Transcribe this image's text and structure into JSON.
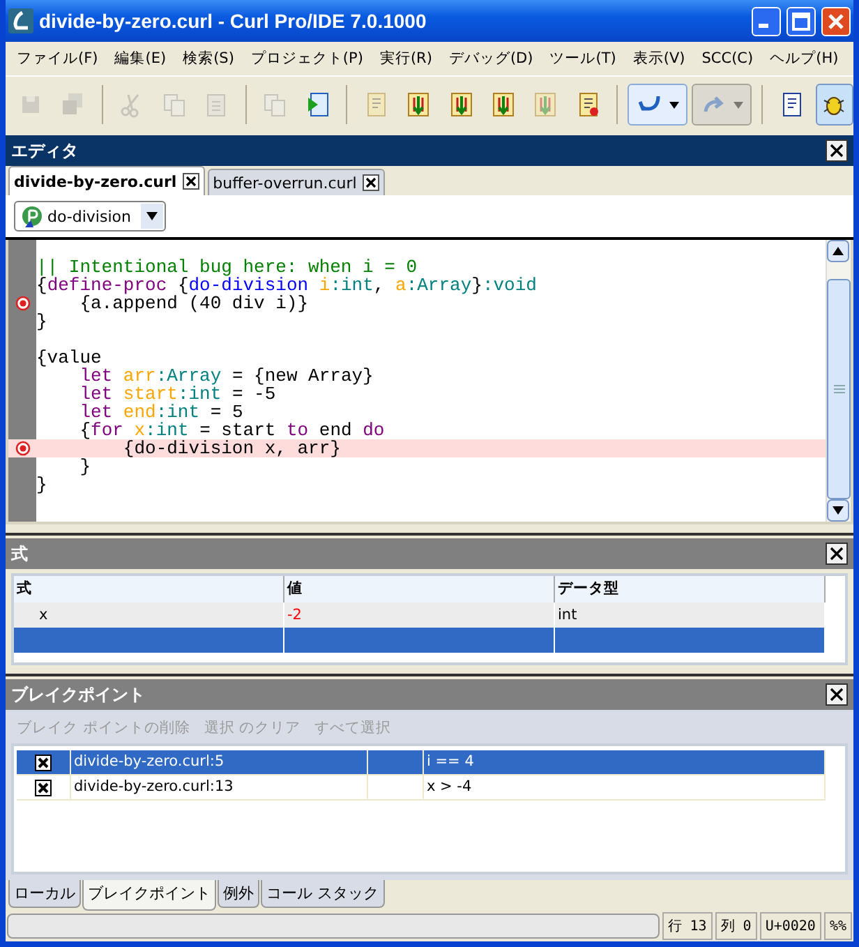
{
  "window": {
    "title": "divide-by-zero.curl - Curl Pro/IDE 7.0.1000"
  },
  "menu": [
    "ファイル(F)",
    "編集(E)",
    "検索(S)",
    "プロジェクト(P)",
    "実行(R)",
    "デバッグ(D)",
    "ツール(T)",
    "表示(V)",
    "SCC(C)",
    "ヘルプ(H)"
  ],
  "toolbar": [
    [
      {
        "kind": "save",
        "disabled": true,
        "pressed": false
      },
      {
        "kind": "save-all",
        "disabled": true,
        "pressed": false
      }
    ],
    [
      {
        "kind": "cut",
        "disabled": true,
        "pressed": false
      },
      {
        "kind": "copy",
        "disabled": true,
        "pressed": false
      },
      {
        "kind": "paste",
        "disabled": true,
        "pressed": false
      }
    ],
    [
      {
        "kind": "documents",
        "disabled": true,
        "pressed": false
      },
      {
        "kind": "run",
        "disabled": false,
        "pressed": false
      }
    ],
    [
      {
        "kind": "document",
        "disabled": true,
        "pressed": false
      },
      {
        "kind": "step-into",
        "disabled": false,
        "pressed": false
      },
      {
        "kind": "step-over",
        "disabled": false,
        "pressed": false
      },
      {
        "kind": "step-out",
        "disabled": false,
        "pressed": false
      },
      {
        "kind": "step-over",
        "disabled": true,
        "pressed": false
      },
      {
        "kind": "stop",
        "disabled": false,
        "pressed": false
      }
    ],
    [
      {
        "kind": "undo",
        "disabled": false,
        "pressed": false
      },
      {
        "kind": "redo",
        "disabled": true,
        "pressed": false
      }
    ],
    [
      {
        "kind": "page",
        "disabled": false,
        "pressed": false
      },
      {
        "kind": "bug",
        "disabled": false,
        "pressed": true
      }
    ]
  ],
  "editor": {
    "title": "エディタ",
    "active": true,
    "tabs": [
      {
        "label": "divide-by-zero.curl",
        "selected": true
      },
      {
        "label": "buffer-overrun.curl",
        "selected": false
      }
    ],
    "procedure": "do-division",
    "lines": [
      {
        "breakpoint": false,
        "highlighted": false,
        "tokens": [
          {
            "t": "|| Intentional bug here: when i = 0",
            "kind": "comment"
          }
        ]
      },
      {
        "breakpoint": false,
        "highlighted": false,
        "tokens": [
          {
            "t": "{",
            "kind": "plain"
          },
          {
            "t": "define-proc",
            "kind": "keyword"
          },
          {
            "t": " {",
            "kind": "plain"
          },
          {
            "t": "do-division ",
            "kind": "name"
          },
          {
            "t": "i",
            "kind": "var"
          },
          {
            "t": ":int",
            "kind": "type"
          },
          {
            "t": ", ",
            "kind": "plain"
          },
          {
            "t": "a",
            "kind": "var"
          },
          {
            "t": ":Array",
            "kind": "type"
          },
          {
            "t": "}",
            "kind": "plain"
          },
          {
            "t": ":void",
            "kind": "type"
          }
        ]
      },
      {
        "breakpoint": true,
        "highlighted": false,
        "tokens": [
          {
            "t": "    {a.append (40 div i)}",
            "kind": "plain"
          }
        ]
      },
      {
        "breakpoint": false,
        "highlighted": false,
        "tokens": [
          {
            "t": "}",
            "kind": "plain"
          }
        ]
      },
      {
        "breakpoint": false,
        "highlighted": false
      },
      {
        "breakpoint": false,
        "highlighted": false,
        "tokens": [
          {
            "t": "{value",
            "kind": "plain"
          }
        ]
      },
      {
        "breakpoint": false,
        "highlighted": false,
        "tokens": [
          {
            "t": "    let ",
            "kind": "keyword"
          },
          {
            "t": "arr",
            "kind": "var"
          },
          {
            "t": ":Array",
            "kind": "type"
          },
          {
            "t": " = {new Array}",
            "kind": "plain"
          }
        ]
      },
      {
        "breakpoint": false,
        "highlighted": false,
        "tokens": [
          {
            "t": "    let ",
            "kind": "keyword"
          },
          {
            "t": "start",
            "kind": "var"
          },
          {
            "t": ":int",
            "kind": "type"
          },
          {
            "t": " = -5",
            "kind": "plain"
          }
        ]
      },
      {
        "breakpoint": false,
        "highlighted": false,
        "tokens": [
          {
            "t": "    let ",
            "kind": "keyword"
          },
          {
            "t": "end",
            "kind": "var"
          },
          {
            "t": ":int",
            "kind": "type"
          },
          {
            "t": " = 5",
            "kind": "plain"
          }
        ]
      },
      {
        "breakpoint": false,
        "highlighted": false,
        "tokens": [
          {
            "t": "    {",
            "kind": "plain"
          },
          {
            "t": "for ",
            "kind": "keyword"
          },
          {
            "t": "x",
            "kind": "var"
          },
          {
            "t": ":int",
            "kind": "type"
          },
          {
            "t": " = start ",
            "kind": "plain"
          },
          {
            "t": "to",
            "kind": "keyword"
          },
          {
            "t": " end ",
            "kind": "plain"
          },
          {
            "t": "do",
            "kind": "keyword"
          }
        ]
      },
      {
        "breakpoint": true,
        "highlighted": true,
        "tokens": [
          {
            "t": "        {do-division x, arr}",
            "kind": "plain"
          }
        ]
      },
      {
        "breakpoint": false,
        "highlighted": false,
        "tokens": [
          {
            "t": "    }",
            "kind": "plain"
          }
        ]
      },
      {
        "breakpoint": false,
        "highlighted": false,
        "tokens": [
          {
            "t": "}",
            "kind": "plain"
          }
        ]
      }
    ]
  },
  "expressions": {
    "title": "式",
    "active": false,
    "columns": [
      "式",
      "値",
      "データ型"
    ],
    "rows": [
      {
        "selected": false,
        "changed": true,
        "cells": [
          "x",
          "-2",
          "int"
        ]
      },
      {
        "selected": true
      }
    ]
  },
  "breakpoints": {
    "title": "ブレイクポイント",
    "active": false,
    "actions": [
      {
        "label": "ブレイク ポイントの削除",
        "disabled": true
      },
      {
        "label": "選択 のクリア",
        "disabled": true
      },
      {
        "label": "すべて選択",
        "disabled": true
      }
    ],
    "rows": [
      {
        "checked": true,
        "selected": true,
        "location": "divide-by-zero.curl:5",
        "condition": "i == 4"
      },
      {
        "checked": true,
        "selected": false,
        "location": "divide-by-zero.curl:13",
        "condition": "x > -4"
      }
    ]
  },
  "bottom_tabs": [
    {
      "label": "ローカル",
      "selected": false
    },
    {
      "label": "ブレイクポイント",
      "selected": true
    },
    {
      "label": "例外",
      "selected": false
    },
    {
      "label": "コール スタック",
      "selected": false
    }
  ],
  "status_bar": {
    "line_label": "行",
    "line": "13",
    "column_label": "列",
    "column": "0",
    "char": "U+0020",
    "mode": "%%"
  }
}
